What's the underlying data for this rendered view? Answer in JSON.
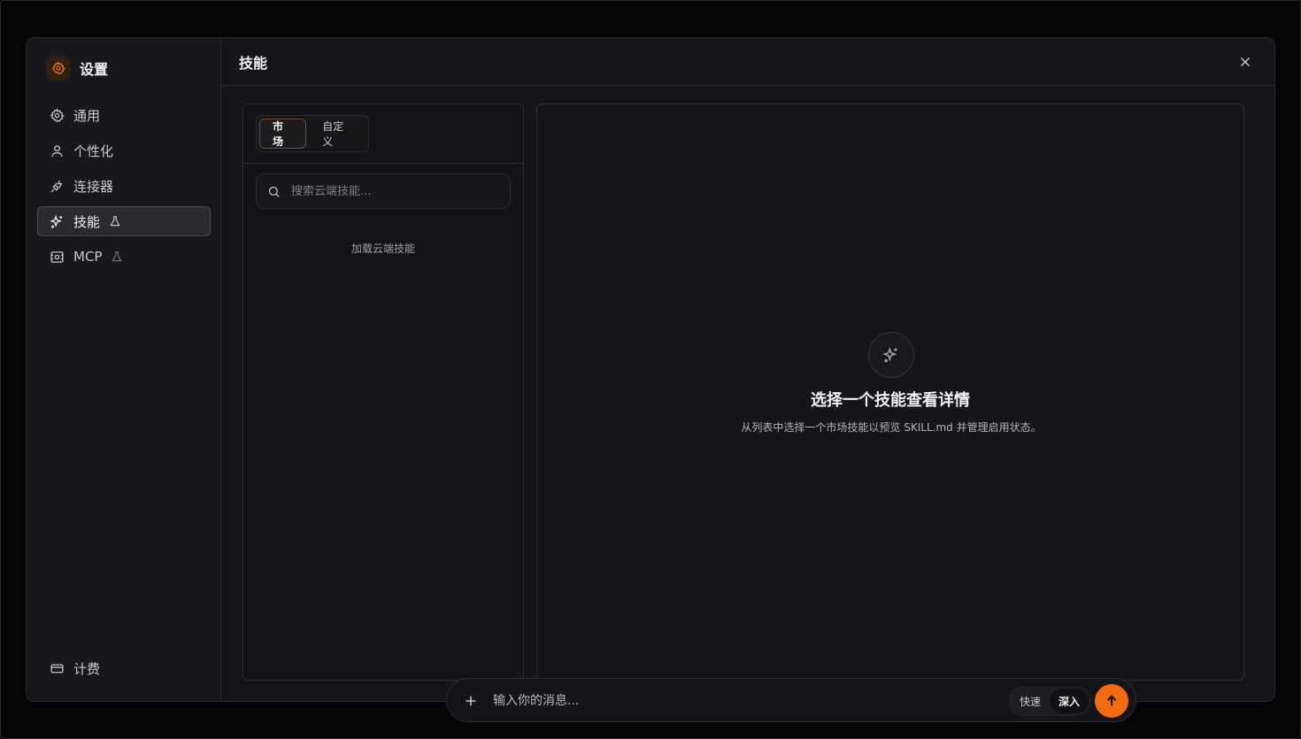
{
  "settings": {
    "title": "设置",
    "brand_color": "#f26b0f"
  },
  "sidebar": {
    "items": [
      {
        "label": "通用",
        "icon": "gear-icon"
      },
      {
        "label": "个性化",
        "icon": "user-icon"
      },
      {
        "label": "连接器",
        "icon": "plug-icon"
      },
      {
        "label": "技能",
        "icon": "sparkles-icon",
        "badge_icon": "flask-icon",
        "active": true
      },
      {
        "label": "MCP",
        "icon": "server-icon",
        "badge_icon": "flask-icon"
      }
    ],
    "bottom_item": {
      "label": "计费",
      "icon": "credit-card-icon"
    }
  },
  "header": {
    "title": "技能"
  },
  "skills_list": {
    "tabs": [
      {
        "label": "市场",
        "active": true
      },
      {
        "label": "自定义",
        "active": false
      }
    ],
    "search_placeholder": "搜索云端技能...",
    "status_text": "加载云端技能"
  },
  "detail": {
    "empty_title": "选择一个技能查看详情",
    "empty_description": "从列表中选择一个市场技能以预览 SKILL.md 并管理启用状态。"
  },
  "composer": {
    "placeholder": "输入你的消息...",
    "modes": [
      {
        "label": "快速",
        "active": false
      },
      {
        "label": "深入",
        "active": true
      }
    ]
  }
}
